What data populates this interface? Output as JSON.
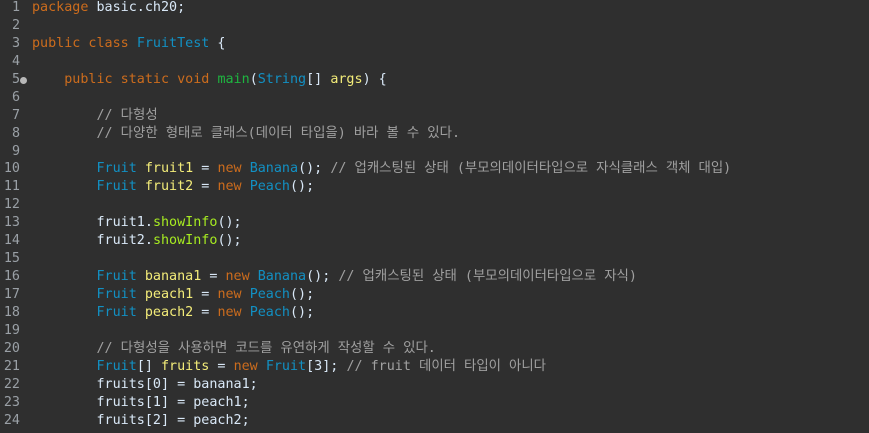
{
  "editor": {
    "language": "java",
    "colors": {
      "background": "#2f2f2f",
      "line_number": "#9aa0a6",
      "keyword": "#cc6c1d",
      "type": "#1290c3",
      "declared_variable": "#f3ec79",
      "method_call": "#a7ec21",
      "method_declaration": "#1eb540",
      "comment": "#a0a0a0",
      "plain": "#d9e8f7"
    },
    "lines": [
      {
        "n": "1",
        "marker": false,
        "tokens": [
          [
            "kw",
            "package"
          ],
          [
            "p",
            " basic.ch20;"
          ]
        ]
      },
      {
        "n": "2",
        "marker": false,
        "tokens": []
      },
      {
        "n": "3",
        "marker": false,
        "tokens": [
          [
            "kw",
            "public class"
          ],
          [
            "p",
            " "
          ],
          [
            "ty",
            "FruitTest"
          ],
          [
            "p",
            " {"
          ]
        ]
      },
      {
        "n": "4",
        "marker": false,
        "tokens": []
      },
      {
        "n": "5",
        "marker": true,
        "tokens": [
          [
            "p",
            "    "
          ],
          [
            "kw",
            "public static void"
          ],
          [
            "p",
            " "
          ],
          [
            "fn",
            "main"
          ],
          [
            "p",
            "("
          ],
          [
            "ty",
            "String"
          ],
          [
            "p",
            "[] "
          ],
          [
            "var",
            "args"
          ],
          [
            "p",
            ") {"
          ]
        ]
      },
      {
        "n": "6",
        "marker": false,
        "tokens": []
      },
      {
        "n": "7",
        "marker": false,
        "tokens": [
          [
            "p",
            "        "
          ],
          [
            "cm",
            "// 다형성"
          ]
        ]
      },
      {
        "n": "8",
        "marker": false,
        "tokens": [
          [
            "p",
            "        "
          ],
          [
            "cm",
            "// 다양한 형태로 클래스(데이터 타입을) 바라 볼 수 있다."
          ]
        ]
      },
      {
        "n": "9",
        "marker": false,
        "tokens": []
      },
      {
        "n": "10",
        "marker": false,
        "tokens": [
          [
            "p",
            "        "
          ],
          [
            "ty",
            "Fruit"
          ],
          [
            "p",
            " "
          ],
          [
            "var",
            "fruit1"
          ],
          [
            "p",
            " = "
          ],
          [
            "kw",
            "new"
          ],
          [
            "p",
            " "
          ],
          [
            "ty",
            "Banana"
          ],
          [
            "p",
            "(); "
          ],
          [
            "cm",
            "// 업캐스팅된 상태 (부모의데이터타입으로 자식클래스 객체 대입)"
          ]
        ]
      },
      {
        "n": "11",
        "marker": false,
        "tokens": [
          [
            "p",
            "        "
          ],
          [
            "ty",
            "Fruit"
          ],
          [
            "p",
            " "
          ],
          [
            "var",
            "fruit2"
          ],
          [
            "p",
            " = "
          ],
          [
            "kw",
            "new"
          ],
          [
            "p",
            " "
          ],
          [
            "ty",
            "Peach"
          ],
          [
            "p",
            "();"
          ]
        ]
      },
      {
        "n": "12",
        "marker": false,
        "tokens": []
      },
      {
        "n": "13",
        "marker": false,
        "tokens": [
          [
            "p",
            "        fruit1."
          ],
          [
            "mth",
            "showInfo"
          ],
          [
            "p",
            "();"
          ]
        ]
      },
      {
        "n": "14",
        "marker": false,
        "tokens": [
          [
            "p",
            "        fruit2."
          ],
          [
            "mth",
            "showInfo"
          ],
          [
            "p",
            "();"
          ]
        ]
      },
      {
        "n": "15",
        "marker": false,
        "tokens": []
      },
      {
        "n": "16",
        "marker": false,
        "tokens": [
          [
            "p",
            "        "
          ],
          [
            "ty",
            "Fruit"
          ],
          [
            "p",
            " "
          ],
          [
            "var",
            "banana1"
          ],
          [
            "p",
            " = "
          ],
          [
            "kw",
            "new"
          ],
          [
            "p",
            " "
          ],
          [
            "ty",
            "Banana"
          ],
          [
            "p",
            "(); "
          ],
          [
            "cm",
            "// 업캐스팅된 상태 (부모의데이터타입으로 자식)"
          ]
        ]
      },
      {
        "n": "17",
        "marker": false,
        "tokens": [
          [
            "p",
            "        "
          ],
          [
            "ty",
            "Fruit"
          ],
          [
            "p",
            " "
          ],
          [
            "var",
            "peach1"
          ],
          [
            "p",
            " = "
          ],
          [
            "kw",
            "new"
          ],
          [
            "p",
            " "
          ],
          [
            "ty",
            "Peach"
          ],
          [
            "p",
            "();"
          ]
        ]
      },
      {
        "n": "18",
        "marker": false,
        "tokens": [
          [
            "p",
            "        "
          ],
          [
            "ty",
            "Fruit"
          ],
          [
            "p",
            " "
          ],
          [
            "var",
            "peach2"
          ],
          [
            "p",
            " = "
          ],
          [
            "kw",
            "new"
          ],
          [
            "p",
            " "
          ],
          [
            "ty",
            "Peach"
          ],
          [
            "p",
            "();"
          ]
        ]
      },
      {
        "n": "19",
        "marker": false,
        "tokens": []
      },
      {
        "n": "20",
        "marker": false,
        "tokens": [
          [
            "p",
            "        "
          ],
          [
            "cm",
            "// 다형성을 사용하면 코드를 유연하게 작성할 수 있다."
          ]
        ]
      },
      {
        "n": "21",
        "marker": false,
        "tokens": [
          [
            "p",
            "        "
          ],
          [
            "ty",
            "Fruit"
          ],
          [
            "p",
            "[] "
          ],
          [
            "var",
            "fruits"
          ],
          [
            "p",
            " = "
          ],
          [
            "kw",
            "new"
          ],
          [
            "p",
            " "
          ],
          [
            "ty",
            "Fruit"
          ],
          [
            "p",
            "[3]; "
          ],
          [
            "cm",
            "// fruit 데이터 타입이 아니다"
          ]
        ]
      },
      {
        "n": "22",
        "marker": false,
        "tokens": [
          [
            "p",
            "        fruits[0] = banana1;"
          ]
        ]
      },
      {
        "n": "23",
        "marker": false,
        "tokens": [
          [
            "p",
            "        fruits[1] = peach1;"
          ]
        ]
      },
      {
        "n": "24",
        "marker": false,
        "tokens": [
          [
            "p",
            "        fruits[2] = peach2;"
          ]
        ]
      }
    ]
  }
}
